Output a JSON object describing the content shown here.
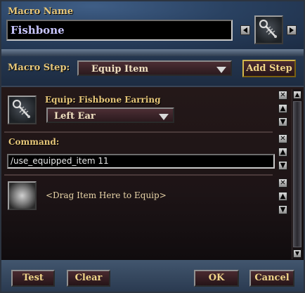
{
  "macro_name": {
    "label": "Macro Name",
    "value": "Fishbone",
    "icon": "fishbone-earring-icon"
  },
  "macro_step": {
    "label": "Macro Step:",
    "selected": "Equip Item",
    "add_step_label": "Add Step"
  },
  "steps": {
    "equip": {
      "title": "Equip: Fishbone Earring",
      "slot": "Left Ear",
      "icon": "fishbone-earring-icon"
    },
    "command": {
      "label": "Command:",
      "value": "/use_equipped_item 11"
    },
    "drag": {
      "text": "<Drag Item Here to Equip>"
    }
  },
  "buttons": {
    "test": "Test",
    "clear": "Clear",
    "ok": "OK",
    "cancel": "Cancel"
  },
  "colors": {
    "label_gold": "#e8c87a",
    "name_text": "#c9c6ff",
    "button_gold": "#d4b84c"
  }
}
